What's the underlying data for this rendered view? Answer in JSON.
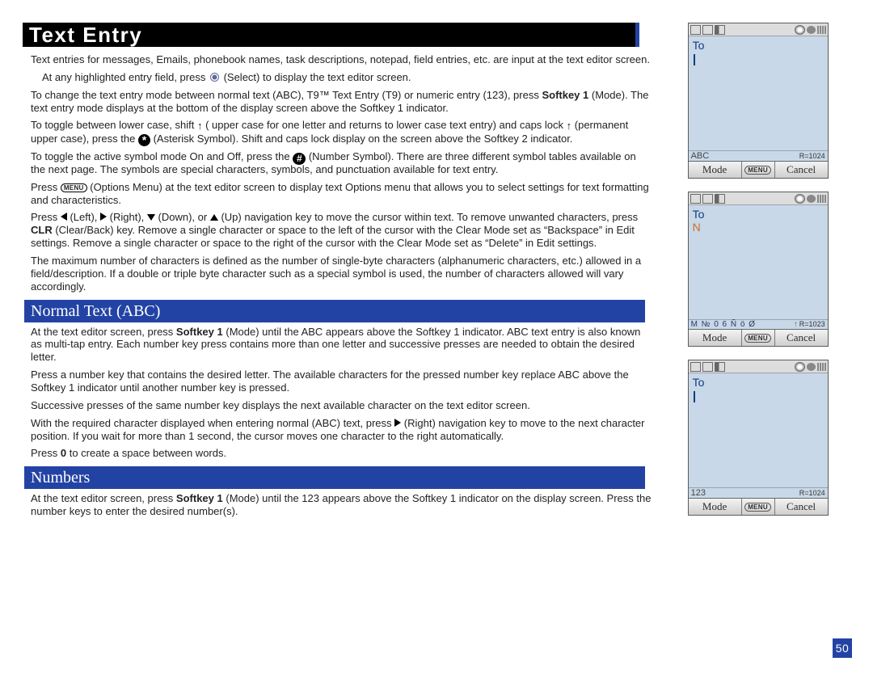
{
  "title": "Text Entry",
  "paras": {
    "p1": "Text entries for messages, Emails, phonebook names, task descriptions, notepad, field entries, etc. are input at the text editor screen.",
    "p2a": "At any highlighted entry field, press ",
    "p2b": " (Select) to display the text editor screen.",
    "p3a": "To change the text entry mode between normal text (ABC), T9™ Text Entry (T9) or numeric entry (123), press ",
    "p3b": "Softkey 1",
    "p3c": " (Mode). The text entry mode displays at the bottom of the display screen above the Softkey 1 indicator.",
    "p4a": "To toggle between lower case, shift ",
    "p4b": " ( upper case for one letter and returns to lower case text entry) and caps lock ",
    "p4c": "(permanent upper case), press the ",
    "p4d": " (Asterisk Symbol). Shift and caps lock display on the screen above the Softkey 2 indicator.",
    "p5a": "To toggle the active symbol mode On and Off, press the ",
    "p5b": " (Number Symbol). There are three different symbol tables available on the next page. The symbols are special characters, symbols, and punctuation available for text entry.",
    "p6a": "Press ",
    "p6b": " (Options Menu) at the text editor screen to display text Options menu that allows you to select settings for text formatting and characteristics.",
    "p7a": "Press ",
    "p7b": " (Left), ",
    "p7c": " (Right), ",
    "p7d": " (Down), or ",
    "p7e": " (Up) navigation key to move the cursor within text. To remove unwanted characters, press ",
    "p7f": "CLR",
    "p7g": " (Clear/Back) key. Remove a single character or space to the left of the cursor with the Clear Mode set as “Backspace” in Edit settings. Remove a single character or space to the right of the cursor with the Clear Mode set as “Delete” in Edit settings.",
    "p8": "The maximum number of characters is defined as the number of single-byte characters (alphanumeric characters, etc.) allowed in a field/description. If a double or triple byte character such as a special symbol is used, the number of characters allowed will vary accordingly."
  },
  "sections": {
    "abc": "Normal Text (ABC)",
    "num": "Numbers"
  },
  "abc": {
    "p1a": "At the text editor screen, press ",
    "p1b": "Softkey 1",
    "p1c": " (Mode) until the ABC appears above the Softkey 1 indicator. ABC text entry is also known as multi-tap entry. Each number key press contains more than one letter and successive presses are needed to obtain the desired letter.",
    "p2": "Press a number key that contains the desired letter. The available characters for the pressed number key replace ABC above the Softkey 1 indicator until another number key is pressed.",
    "p3": "Successive presses of the same number key displays the next available character on the text editor screen.",
    "p4a": "With the required character displayed when entering normal (ABC) text, press ",
    "p4b": " (Right) navigation key to move to the next character position. If you wait for more than 1 second, the cursor moves one character to the right automatically.",
    "p5a": "Press ",
    "p5b": "0",
    "p5c": " to create a space between words."
  },
  "num": {
    "p1a": "At the text editor screen, press ",
    "p1b": "Softkey 1",
    "p1c": " (Mode) until the 123 appears above the Softkey 1 indicator on the display screen. Press the number keys to enter the desired number(s)."
  },
  "phones": {
    "p1": {
      "to": "To",
      "modeL": "ABC",
      "modeR": "R=1024",
      "skL": "Mode",
      "skM": "MENU",
      "skR": "Cancel",
      "content": ""
    },
    "p2": {
      "to": "To",
      "modeL": "M № 0 6 Ñ ö Ø",
      "modeR": "R=1023",
      "skL": "Mode",
      "skM": "MENU",
      "skR": "Cancel",
      "content": "N"
    },
    "p3": {
      "to": "To",
      "modeL": "123",
      "modeR": "R=1024",
      "skL": "Mode",
      "skM": "MENU",
      "skR": "Cancel",
      "content": ""
    }
  },
  "pageNumber": "50"
}
